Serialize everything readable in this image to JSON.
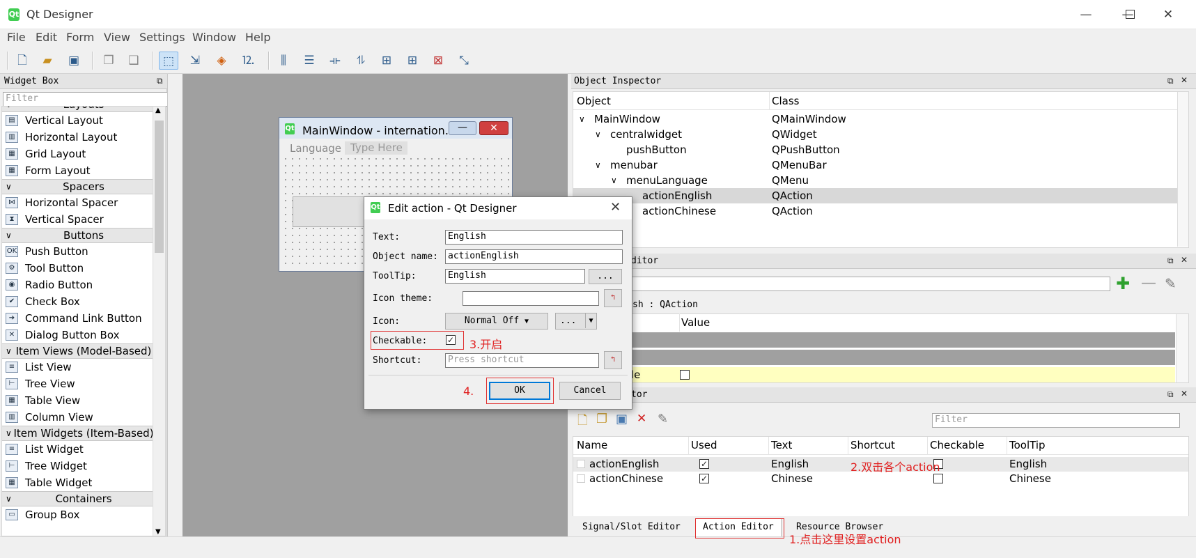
{
  "app": {
    "title": "Qt Designer",
    "icon": "Qt"
  },
  "menubar": [
    "File",
    "Edit",
    "Form",
    "View",
    "Settings",
    "Window",
    "Help"
  ],
  "widget_box": {
    "title": "Widget Box",
    "filter_placeholder": "Filter",
    "rows": [
      {
        "type": "cat",
        "label": "Layouts"
      },
      {
        "type": "item",
        "label": "Vertical Layout",
        "icon": "▤"
      },
      {
        "type": "item",
        "label": "Horizontal Layout",
        "icon": "▥"
      },
      {
        "type": "item",
        "label": "Grid Layout",
        "icon": "▦"
      },
      {
        "type": "item",
        "label": "Form Layout",
        "icon": "▦"
      },
      {
        "type": "cat",
        "label": "Spacers"
      },
      {
        "type": "item",
        "label": "Horizontal Spacer",
        "icon": "⋈"
      },
      {
        "type": "item",
        "label": "Vertical Spacer",
        "icon": "⧗"
      },
      {
        "type": "cat",
        "label": "Buttons"
      },
      {
        "type": "item",
        "label": "Push Button",
        "icon": "OK"
      },
      {
        "type": "item",
        "label": "Tool Button",
        "icon": "⚙"
      },
      {
        "type": "item",
        "label": "Radio Button",
        "icon": "◉"
      },
      {
        "type": "item",
        "label": "Check Box",
        "icon": "✔"
      },
      {
        "type": "item",
        "label": "Command Link Button",
        "icon": "➔"
      },
      {
        "type": "item",
        "label": "Dialog Button Box",
        "icon": "✕"
      },
      {
        "type": "cat",
        "label": "Item Views (Model-Based)"
      },
      {
        "type": "item",
        "label": "List View",
        "icon": "≡"
      },
      {
        "type": "item",
        "label": "Tree View",
        "icon": "⊢"
      },
      {
        "type": "item",
        "label": "Table View",
        "icon": "▦"
      },
      {
        "type": "item",
        "label": "Column View",
        "icon": "▥"
      },
      {
        "type": "cat",
        "label": "Item Widgets (Item-Based)"
      },
      {
        "type": "item",
        "label": "List Widget",
        "icon": "≡"
      },
      {
        "type": "item",
        "label": "Tree Widget",
        "icon": "⊢"
      },
      {
        "type": "item",
        "label": "Table Widget",
        "icon": "▦"
      },
      {
        "type": "cat",
        "label": "Containers"
      },
      {
        "type": "item",
        "label": "Group Box",
        "icon": "▭"
      }
    ]
  },
  "form_window": {
    "title": "MainWindow - internation...",
    "menu": [
      "Language",
      "Type Here"
    ]
  },
  "object_inspector": {
    "title": "Object Inspector",
    "col_object": "Object",
    "col_class": "Class",
    "rows": [
      {
        "name": "MainWindow",
        "class": "QMainWindow",
        "depth": 0,
        "arrow": "∨"
      },
      {
        "name": "centralwidget",
        "class": "QWidget",
        "depth": 1,
        "arrow": "∨"
      },
      {
        "name": "pushButton",
        "class": "QPushButton",
        "depth": 2,
        "arrow": ""
      },
      {
        "name": "menubar",
        "class": "QMenuBar",
        "depth": 1,
        "arrow": "∨"
      },
      {
        "name": "menuLanguage",
        "class": "QMenu",
        "depth": 2,
        "arrow": "∨"
      },
      {
        "name": "actionEnglish",
        "class": "QAction",
        "depth": 3,
        "arrow": "",
        "selected": true
      },
      {
        "name": "actionChinese",
        "class": "QAction",
        "depth": 3,
        "arrow": ""
      }
    ]
  },
  "property_editor": {
    "title_fragment": "ditor",
    "subtitle_fragment": "sh : QAction",
    "col_value": "Value",
    "row_fragment": "le"
  },
  "action_editor": {
    "title_fragment": "tor",
    "filter_placeholder": "Filter",
    "columns": [
      "Name",
      "Used",
      "Text",
      "Shortcut",
      "Checkable",
      "ToolTip"
    ],
    "rows": [
      {
        "name": "actionEnglish",
        "used": true,
        "text": "English",
        "shortcut": "",
        "checkable": false,
        "tooltip": "English"
      },
      {
        "name": "actionChinese",
        "used": true,
        "text": "Chinese",
        "shortcut": "",
        "checkable": false,
        "tooltip": "Chinese"
      }
    ]
  },
  "bottom_tabs": [
    "Signal/Slot Editor",
    "Action Editor",
    "Resource Browser"
  ],
  "dialog": {
    "title": "Edit action - Qt Designer",
    "text_label": "Text:",
    "text_value": "English",
    "objname_label": "Object name:",
    "objname_value": "actionEnglish",
    "tooltip_label": "ToolTip:",
    "tooltip_value": "English",
    "tooltip_more": "...",
    "icon_theme_label": "Icon theme:",
    "icon_theme_value": "",
    "icon_label": "Icon:",
    "icon_mode": "Normal Off",
    "icon_more": "...",
    "checkable_label": "Checkable:",
    "checkable_checked": true,
    "shortcut_label": "Shortcut:",
    "shortcut_placeholder": "Press shortcut",
    "ok_label": "OK",
    "cancel_label": "Cancel"
  },
  "annotations": {
    "a1": "1.点击这里设置action",
    "a2": "2.双击各个action",
    "a3": "3.开启",
    "a4": "4."
  },
  "colors": {
    "accent_red": "#e02020",
    "selection": "#d8d8d8",
    "highlight_yellow": "#ffffc0"
  }
}
